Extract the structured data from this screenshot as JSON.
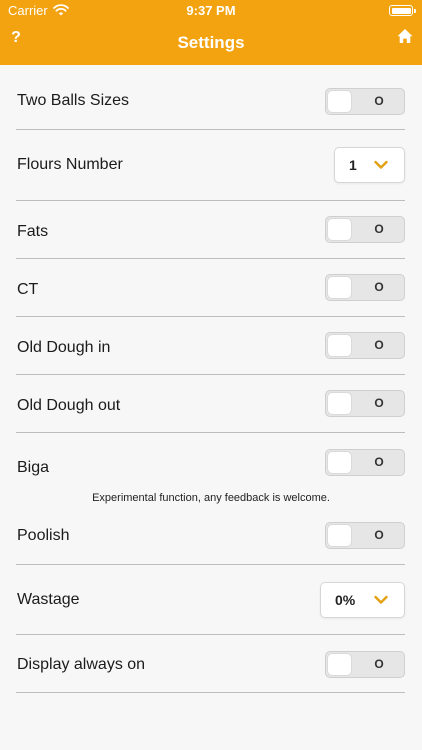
{
  "status_bar": {
    "carrier": "Carrier",
    "time": "9:37 PM"
  },
  "nav": {
    "help_label": "?",
    "title": "Settings"
  },
  "rows": {
    "two_balls_sizes": {
      "label": "Two Balls Sizes",
      "toggle_text": "O"
    },
    "flours_number": {
      "label": "Flours Number",
      "value": "1"
    },
    "fats": {
      "label": "Fats",
      "toggle_text": "O"
    },
    "ct": {
      "label": "CT",
      "toggle_text": "O"
    },
    "old_dough_in": {
      "label": "Old Dough in",
      "toggle_text": "O"
    },
    "old_dough_out": {
      "label": "Old Dough out",
      "toggle_text": "O"
    },
    "biga": {
      "label": "Biga",
      "toggle_text": "O",
      "note": "Experimental function, any feedback is welcome."
    },
    "poolish": {
      "label": "Poolish",
      "toggle_text": "O"
    },
    "wastage": {
      "label": "Wastage",
      "value": "0%"
    },
    "display_always_on": {
      "label": "Display always on",
      "toggle_text": "O"
    }
  },
  "icons": {
    "wifi": "wifi-icon",
    "battery": "battery-icon",
    "home": "home-icon",
    "chevron": "chevron-down-icon"
  },
  "colors": {
    "accent": "#f2a30f",
    "header_text": "#ffffff",
    "background": "#f7f7f7",
    "separator": "#bdbdbd",
    "chevron": "#e2a012"
  }
}
